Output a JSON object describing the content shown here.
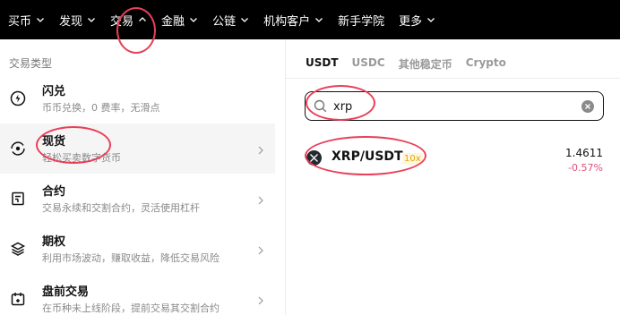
{
  "nav": {
    "items": [
      {
        "label": "买币",
        "chevron": true
      },
      {
        "label": "发现",
        "chevron": true
      },
      {
        "label": "交易",
        "chevron": true
      },
      {
        "label": "金融",
        "chevron": true
      },
      {
        "label": "公链",
        "chevron": true
      },
      {
        "label": "机构客户",
        "chevron": true
      },
      {
        "label": "新手学院",
        "chevron": false
      },
      {
        "label": "更多",
        "chevron": true
      }
    ]
  },
  "left": {
    "title": "交易类型",
    "items": [
      {
        "title": "闪兑",
        "desc": "币币兑换，0 费率，无滑点",
        "icon": "flash-convert-icon",
        "arrow": false
      },
      {
        "title": "现货",
        "desc": "轻松买卖数字货币",
        "icon": "spot-icon",
        "arrow": true
      },
      {
        "title": "合约",
        "desc": "交易永续和交割合约，灵活使用杠杆",
        "icon": "futures-icon",
        "arrow": true
      },
      {
        "title": "期权",
        "desc": "利用市场波动，赚取收益，降低交易风险",
        "icon": "options-icon",
        "arrow": true
      },
      {
        "title": "盘前交易",
        "desc": "在币种未上线阶段，提前交易其交割合约",
        "icon": "pre-market-icon",
        "arrow": true
      }
    ]
  },
  "right": {
    "tabs": [
      "USDT",
      "USDC",
      "其他稳定币",
      "Crypto"
    ],
    "active_tab": "USDT",
    "search": {
      "value": "xrp",
      "placeholder": ""
    },
    "results": [
      {
        "pair": "XRP/USDT",
        "leverage": "10x",
        "price": "1.4611",
        "change": "-0.57%",
        "icon": "xrp-icon"
      }
    ]
  },
  "colors": {
    "nav_bg": "#000000",
    "annotation": "#e8405a",
    "negative": "#e0527a",
    "leverage": "#e0a800"
  }
}
